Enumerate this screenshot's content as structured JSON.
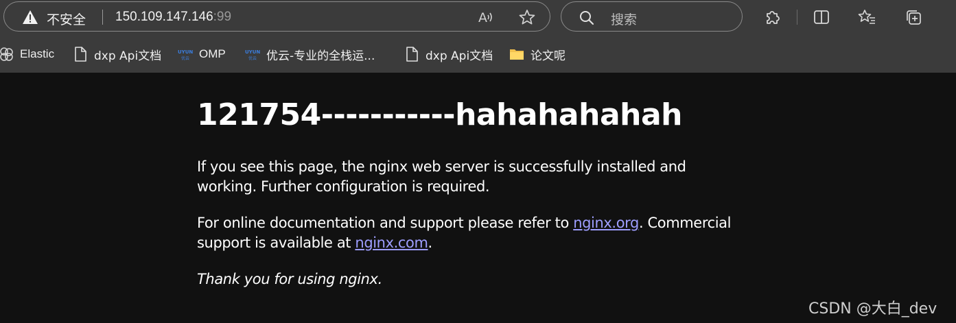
{
  "address_bar": {
    "security_label": "不安全",
    "url_host": "150.109.147.146",
    "url_port": ":99"
  },
  "search": {
    "placeholder": "搜索"
  },
  "icons": {
    "warning": "warning-triangle-icon",
    "read_aloud": "read-aloud-icon",
    "favorite": "star-icon",
    "search": "search-icon",
    "extensions": "puzzle-icon",
    "split_screen": "split-screen-icon",
    "favorites": "favorites-list-icon",
    "collections": "collections-icon"
  },
  "bookmarks": [
    {
      "label": "Elastic",
      "icon": "elastic-icon"
    },
    {
      "label": "dxp Api文档",
      "icon": "page-icon"
    },
    {
      "label": "OMP",
      "icon": "uyun-icon"
    },
    {
      "label": "优云-专业的全栈运...",
      "icon": "uyun-icon"
    },
    {
      "label": "dxp Api文档",
      "icon": "page-icon"
    },
    {
      "label": "论文呢",
      "icon": "folder-icon"
    }
  ],
  "page": {
    "heading": "121754-----------hahahahahah",
    "p1": "If you see this page, the nginx web server is successfully installed and working. Further configuration is required.",
    "p2_prefix": "For online documentation and support please refer to ",
    "p2_link1": "nginx.org",
    "p2_mid": ". Commercial support is available at ",
    "p2_link2": "nginx.com",
    "p2_suffix": ".",
    "p3": "Thank you for using nginx."
  },
  "watermark": "CSDN @大白_dev",
  "colors": {
    "chrome": "#3b3b3b",
    "page_bg": "#111111",
    "link": "#9e9eff",
    "text": "#ffffff"
  }
}
